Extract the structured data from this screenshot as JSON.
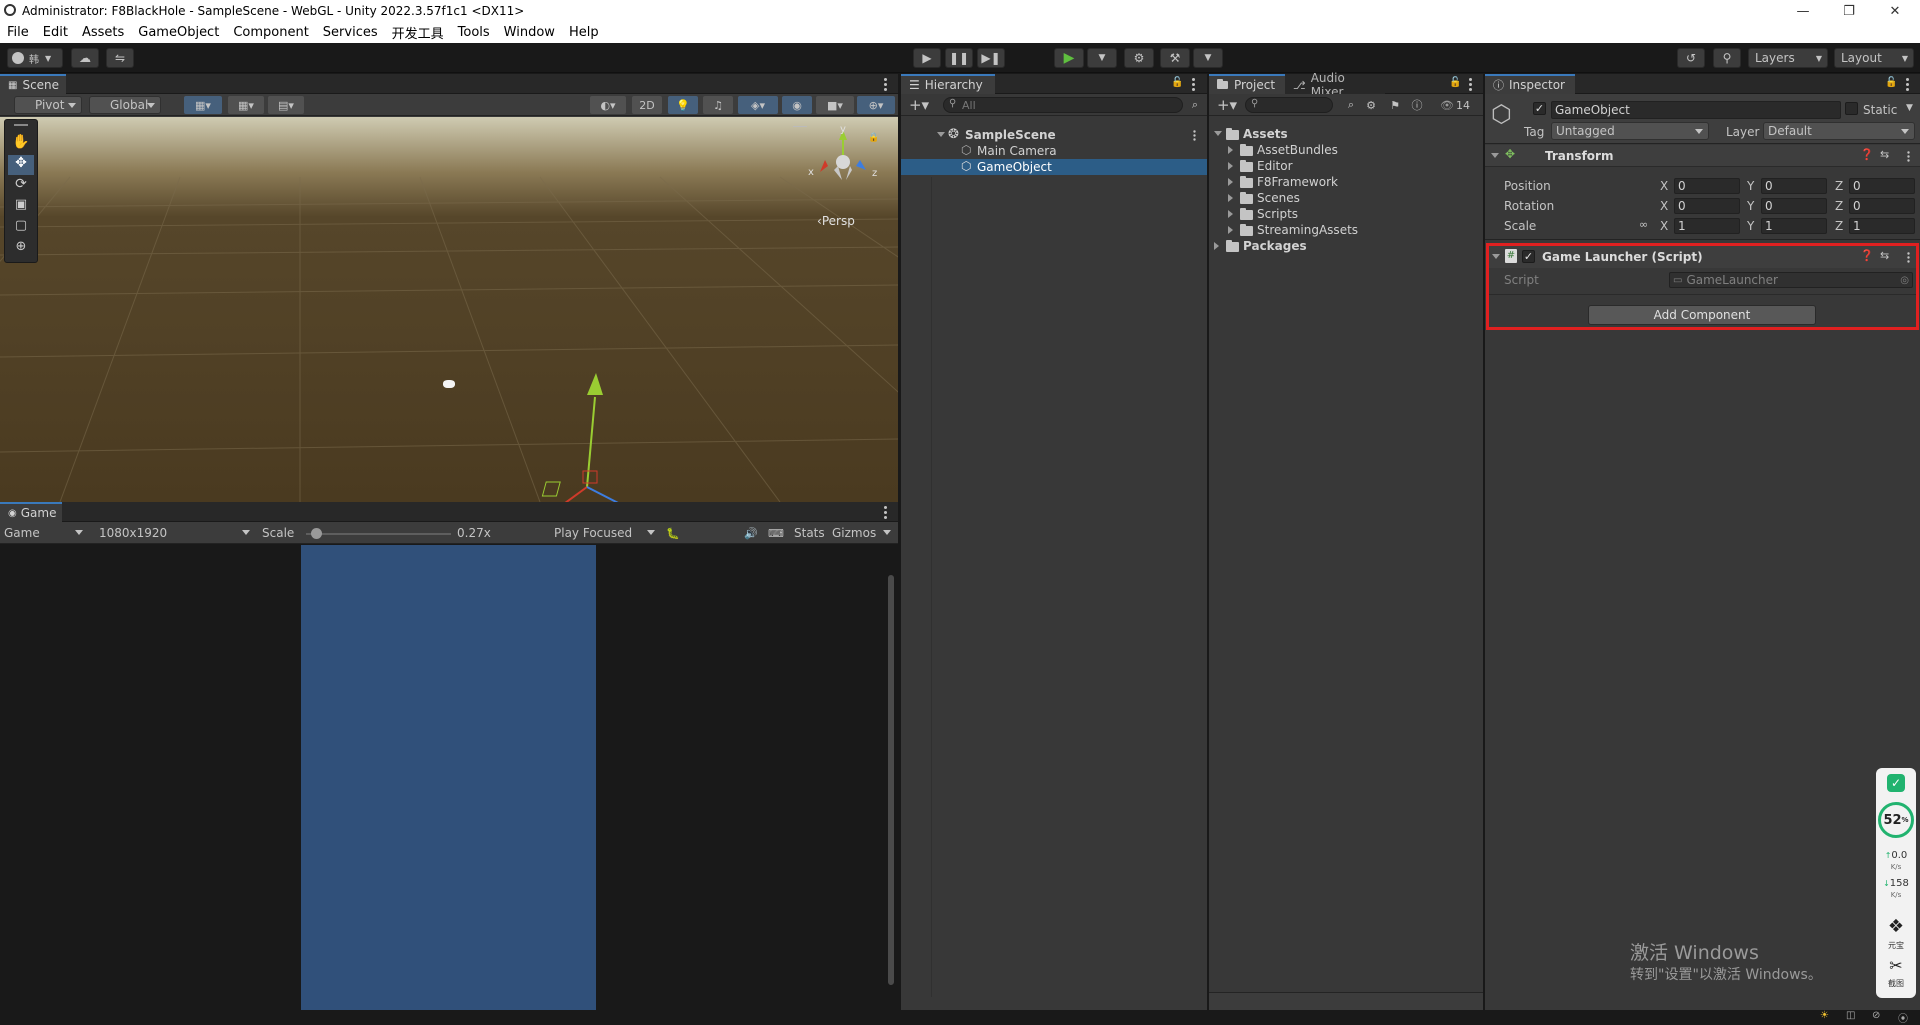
{
  "window": {
    "title": "Administrator: F8BlackHole - SampleScene - WebGL - Unity 2022.3.57f1c1 <DX11>"
  },
  "menu": [
    "File",
    "Edit",
    "Assets",
    "GameObject",
    "Component",
    "Services",
    "开发工具",
    "Tools",
    "Window",
    "Help"
  ],
  "toolbar": {
    "account_label": "韩",
    "layers_label": "Layers",
    "layout_label": "Layout"
  },
  "scene": {
    "tab_label": "Scene",
    "pivot_label": "Pivot",
    "global_label": "Global",
    "mode_2d_label": "2D",
    "persp_label": "Persp",
    "gizmo_axes": {
      "x": "x",
      "y": "y",
      "z": "z"
    }
  },
  "game": {
    "tab_label": "Game",
    "display_label": "Game",
    "resolution_label": "1080x1920",
    "scale_label": "Scale",
    "scale_value": "0.27x",
    "scale_fraction": 0.04,
    "play_mode_label": "Play Focused",
    "stats_label": "Stats",
    "gizmos_label": "Gizmos"
  },
  "hierarchy": {
    "tab_label": "Hierarchy",
    "search_placeholder": "All",
    "scene_name": "SampleScene",
    "items": [
      {
        "label": "Main Camera",
        "selected": false
      },
      {
        "label": "GameObject",
        "selected": true
      }
    ]
  },
  "project": {
    "tab_label": "Project",
    "audio_tab_label": "Audio Mixer",
    "hidden_count": "14",
    "root": "Assets",
    "folders": [
      "AssetBundles",
      "Editor",
      "F8Framework",
      "Scenes",
      "Scripts",
      "StreamingAssets"
    ],
    "packages": "Packages"
  },
  "inspector": {
    "tab_label": "Inspector",
    "object_name": "GameObject",
    "static_label": "Static",
    "tag_label": "Tag",
    "tag_value": "Untagged",
    "layer_label": "Layer",
    "layer_value": "Default",
    "transform": {
      "title": "Transform",
      "rows": [
        {
          "label": "Position",
          "x": "0",
          "y": "0",
          "z": "0"
        },
        {
          "label": "Rotation",
          "x": "0",
          "y": "0",
          "z": "0"
        },
        {
          "label": "Scale",
          "x": "1",
          "y": "1",
          "z": "1"
        }
      ],
      "axis": {
        "x": "X",
        "y": "Y",
        "z": "Z"
      }
    },
    "component": {
      "title": "Game Launcher (Script)",
      "script_label": "Script",
      "script_value": "GameLauncher"
    },
    "add_component_label": "Add Component",
    "highlight_color": "#e02020"
  },
  "overlay": {
    "percent": "52",
    "percent_unit": "%",
    "upload": "0.0",
    "upload_unit": "K/s",
    "download": "158",
    "download_unit": "K/s",
    "tool1_label": "元宝",
    "tool2_label": "截图"
  },
  "watermark": {
    "line1": "激活 Windows",
    "line2": "转到\"设置\"以激活 Windows。"
  }
}
